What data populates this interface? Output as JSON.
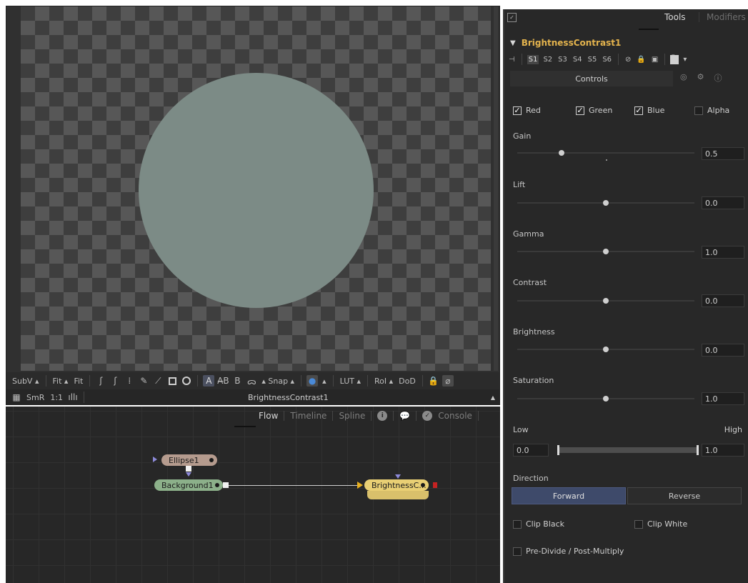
{
  "viewer": {
    "toolbar": {
      "subv": "SubV",
      "fit1": "Fit",
      "fit2": "Fit",
      "a_label": "A",
      "ab_label": "A̶B",
      "b_label": "B",
      "snap": "Snap",
      "lut": "LUT",
      "roi": "RoI",
      "dod": "DoD"
    },
    "status": {
      "smr": "SmR",
      "zoom": "1:1",
      "title": "BrightnessContrast1"
    }
  },
  "flow": {
    "tabs": {
      "flow": "Flow",
      "timeline": "Timeline",
      "spline": "Spline",
      "console": "Console"
    },
    "nodes": {
      "ellipse": "Ellipse1",
      "background": "Background1",
      "brightness": "BrightnessC..."
    }
  },
  "inspector": {
    "tabs": {
      "tools": "Tools",
      "modifiers": "Modifiers"
    },
    "tool_name": "BrightnessContrast1",
    "slots": [
      "S1",
      "S2",
      "S3",
      "S4",
      "S5",
      "S6"
    ],
    "controls_tab": "Controls",
    "channels": {
      "red": "Red",
      "green": "Green",
      "blue": "Blue",
      "alpha": "Alpha"
    },
    "sliders": {
      "gain": {
        "label": "Gain",
        "value": "0.5"
      },
      "lift": {
        "label": "Lift",
        "value": "0.0"
      },
      "gamma": {
        "label": "Gamma",
        "value": "1.0"
      },
      "contrast": {
        "label": "Contrast",
        "value": "0.0"
      },
      "brightness": {
        "label": "Brightness",
        "value": "0.0"
      },
      "saturation": {
        "label": "Saturation",
        "value": "1.0"
      }
    },
    "range": {
      "low_label": "Low",
      "high_label": "High",
      "low_value": "0.0",
      "high_value": "1.0"
    },
    "direction": {
      "label": "Direction",
      "forward": "Forward",
      "reverse": "Reverse"
    },
    "options": {
      "clip_black": "Clip Black",
      "clip_white": "Clip White",
      "pre_divide": "Pre-Divide / Post-Multiply"
    }
  },
  "colors": {
    "accent_tool_name": "#e3b34d",
    "ellipse_fill": "#7c8b86",
    "node_ellipse": "#b59b8e",
    "node_background": "#8cb08a",
    "node_brightness": "#e9cf74",
    "direction_active": "#3e4a6a"
  }
}
